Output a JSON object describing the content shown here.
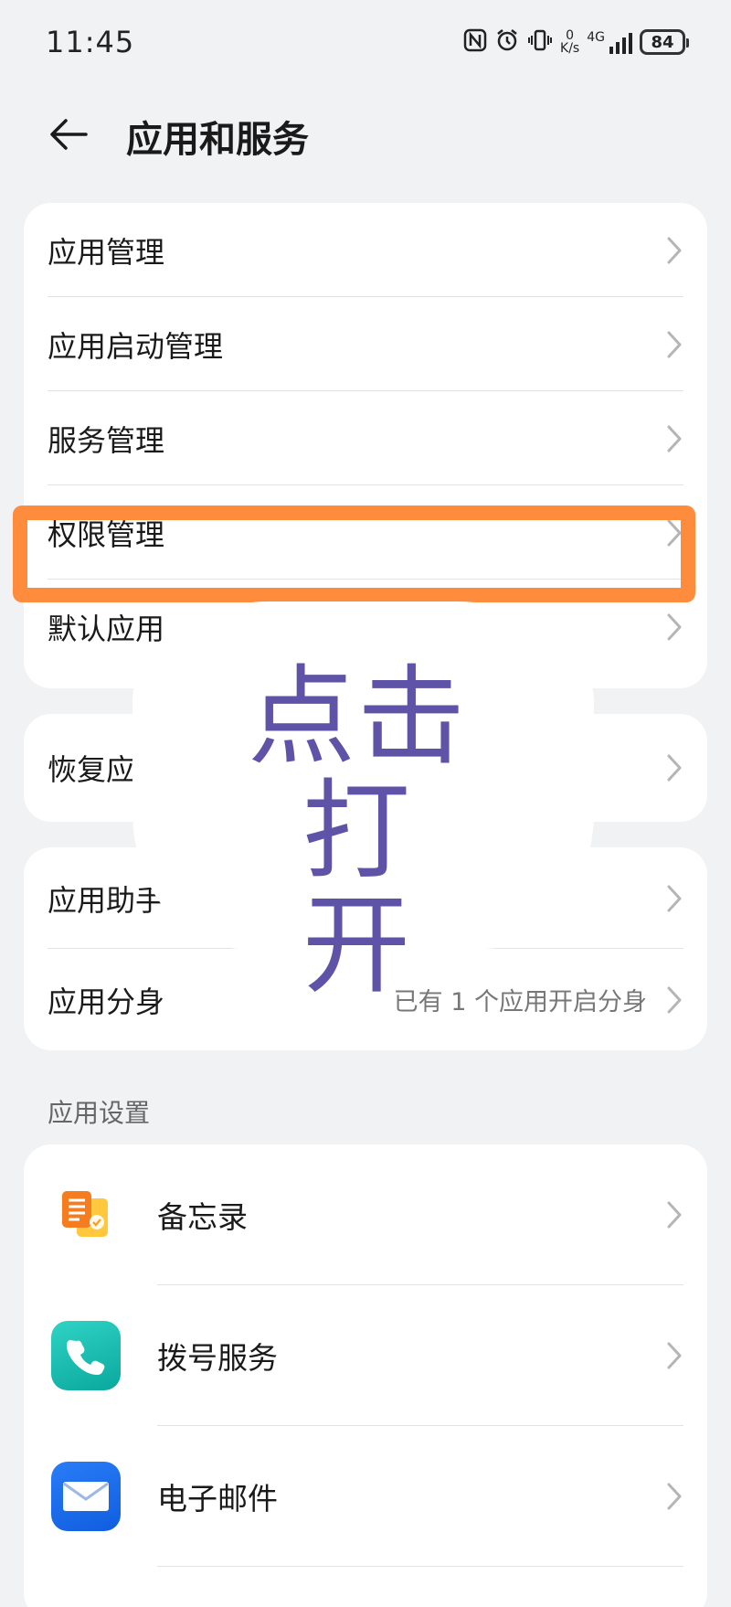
{
  "status_bar": {
    "time": "11:45",
    "net_speed_value": "0",
    "net_speed_unit": "K/s",
    "network_type": "4G",
    "battery": "84"
  },
  "header": {
    "title": "应用和服务"
  },
  "group1": {
    "items": [
      {
        "label": "应用管理"
      },
      {
        "label": "应用启动管理"
      },
      {
        "label": "服务管理"
      },
      {
        "label": "权限管理"
      },
      {
        "label": "默认应用"
      }
    ]
  },
  "group2": {
    "items": [
      {
        "label": "恢复应"
      }
    ]
  },
  "group3": {
    "items": [
      {
        "label": "应用助手",
        "value": ""
      },
      {
        "label": "应用分身",
        "value": "已有 1 个应用开启分身"
      }
    ]
  },
  "app_settings": {
    "section_title": "应用设置",
    "apps": [
      {
        "label": "备忘录",
        "icon": "notes-icon"
      },
      {
        "label": "拨号服务",
        "icon": "phone-icon"
      },
      {
        "label": "电子邮件",
        "icon": "email-icon"
      }
    ]
  },
  "annotation": {
    "text_line1": "点击打",
    "text_line2": "开",
    "highlight_color": "#ff8b3d",
    "text_color": "#5e53a6"
  }
}
